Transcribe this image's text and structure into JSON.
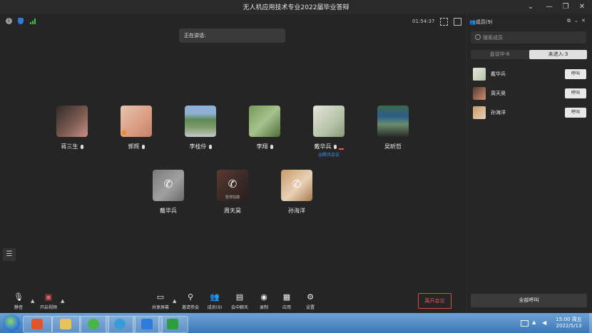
{
  "window": {
    "title": "无人机应用技术专业2022届毕业答辩"
  },
  "status": {
    "timer": "01:54:37"
  },
  "speaking": {
    "label": "正在讲话:"
  },
  "participants": [
    {
      "name": "蒋三生",
      "mic": true
    },
    {
      "name": "郭辉",
      "mic": true
    },
    {
      "name": "李桂伶",
      "mic": true
    },
    {
      "name": "李翔",
      "mic": true
    },
    {
      "name": "戴华兵",
      "mic": true,
      "tag": "@腾讯会议"
    },
    {
      "name": "吴昕哲",
      "mic": false
    }
  ],
  "calling": [
    {
      "name": "戴华兵"
    },
    {
      "name": "周天昊",
      "overlay": "暂停拍摄"
    },
    {
      "name": "孙海洋"
    }
  ],
  "toolbar": {
    "mute": "静音",
    "video": "开启视频",
    "share": "共享屏幕",
    "invite": "邀请参会",
    "members": "成员(9)",
    "chat": "会中聊天",
    "record": "录制",
    "apps": "应用",
    "settings": "设置",
    "leave": "离开会议"
  },
  "sidebar": {
    "header": "成员(9)",
    "search_placeholder": "搜索成员",
    "tabs": [
      "会议中·6",
      "未进入·3"
    ],
    "members": [
      {
        "name": "戴华兵",
        "action": "呼叫"
      },
      {
        "name": "周天昊",
        "action": "呼叫"
      },
      {
        "name": "孙海洋",
        "action": "呼叫"
      }
    ],
    "call_all": "全部呼叫"
  },
  "taskbar": {
    "time": "15:00 周五",
    "date": "2022/5/13"
  }
}
